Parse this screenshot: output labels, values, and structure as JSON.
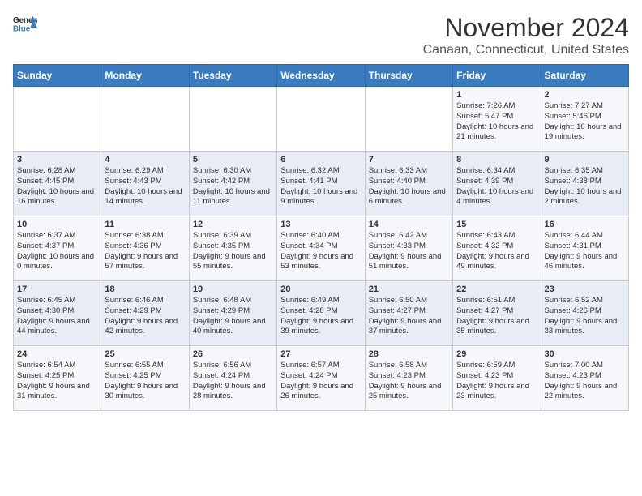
{
  "logo": {
    "text_general": "General",
    "text_blue": "Blue"
  },
  "title": "November 2024",
  "location": "Canaan, Connecticut, United States",
  "weekdays": [
    "Sunday",
    "Monday",
    "Tuesday",
    "Wednesday",
    "Thursday",
    "Friday",
    "Saturday"
  ],
  "weeks": [
    [
      {
        "day": "",
        "info": ""
      },
      {
        "day": "",
        "info": ""
      },
      {
        "day": "",
        "info": ""
      },
      {
        "day": "",
        "info": ""
      },
      {
        "day": "",
        "info": ""
      },
      {
        "day": "1",
        "info": "Sunrise: 7:26 AM\nSunset: 5:47 PM\nDaylight: 10 hours and 21 minutes."
      },
      {
        "day": "2",
        "info": "Sunrise: 7:27 AM\nSunset: 5:46 PM\nDaylight: 10 hours and 19 minutes."
      }
    ],
    [
      {
        "day": "3",
        "info": "Sunrise: 6:28 AM\nSunset: 4:45 PM\nDaylight: 10 hours and 16 minutes."
      },
      {
        "day": "4",
        "info": "Sunrise: 6:29 AM\nSunset: 4:43 PM\nDaylight: 10 hours and 14 minutes."
      },
      {
        "day": "5",
        "info": "Sunrise: 6:30 AM\nSunset: 4:42 PM\nDaylight: 10 hours and 11 minutes."
      },
      {
        "day": "6",
        "info": "Sunrise: 6:32 AM\nSunset: 4:41 PM\nDaylight: 10 hours and 9 minutes."
      },
      {
        "day": "7",
        "info": "Sunrise: 6:33 AM\nSunset: 4:40 PM\nDaylight: 10 hours and 6 minutes."
      },
      {
        "day": "8",
        "info": "Sunrise: 6:34 AM\nSunset: 4:39 PM\nDaylight: 10 hours and 4 minutes."
      },
      {
        "day": "9",
        "info": "Sunrise: 6:35 AM\nSunset: 4:38 PM\nDaylight: 10 hours and 2 minutes."
      }
    ],
    [
      {
        "day": "10",
        "info": "Sunrise: 6:37 AM\nSunset: 4:37 PM\nDaylight: 10 hours and 0 minutes."
      },
      {
        "day": "11",
        "info": "Sunrise: 6:38 AM\nSunset: 4:36 PM\nDaylight: 9 hours and 57 minutes."
      },
      {
        "day": "12",
        "info": "Sunrise: 6:39 AM\nSunset: 4:35 PM\nDaylight: 9 hours and 55 minutes."
      },
      {
        "day": "13",
        "info": "Sunrise: 6:40 AM\nSunset: 4:34 PM\nDaylight: 9 hours and 53 minutes."
      },
      {
        "day": "14",
        "info": "Sunrise: 6:42 AM\nSunset: 4:33 PM\nDaylight: 9 hours and 51 minutes."
      },
      {
        "day": "15",
        "info": "Sunrise: 6:43 AM\nSunset: 4:32 PM\nDaylight: 9 hours and 49 minutes."
      },
      {
        "day": "16",
        "info": "Sunrise: 6:44 AM\nSunset: 4:31 PM\nDaylight: 9 hours and 46 minutes."
      }
    ],
    [
      {
        "day": "17",
        "info": "Sunrise: 6:45 AM\nSunset: 4:30 PM\nDaylight: 9 hours and 44 minutes."
      },
      {
        "day": "18",
        "info": "Sunrise: 6:46 AM\nSunset: 4:29 PM\nDaylight: 9 hours and 42 minutes."
      },
      {
        "day": "19",
        "info": "Sunrise: 6:48 AM\nSunset: 4:29 PM\nDaylight: 9 hours and 40 minutes."
      },
      {
        "day": "20",
        "info": "Sunrise: 6:49 AM\nSunset: 4:28 PM\nDaylight: 9 hours and 39 minutes."
      },
      {
        "day": "21",
        "info": "Sunrise: 6:50 AM\nSunset: 4:27 PM\nDaylight: 9 hours and 37 minutes."
      },
      {
        "day": "22",
        "info": "Sunrise: 6:51 AM\nSunset: 4:27 PM\nDaylight: 9 hours and 35 minutes."
      },
      {
        "day": "23",
        "info": "Sunrise: 6:52 AM\nSunset: 4:26 PM\nDaylight: 9 hours and 33 minutes."
      }
    ],
    [
      {
        "day": "24",
        "info": "Sunrise: 6:54 AM\nSunset: 4:25 PM\nDaylight: 9 hours and 31 minutes."
      },
      {
        "day": "25",
        "info": "Sunrise: 6:55 AM\nSunset: 4:25 PM\nDaylight: 9 hours and 30 minutes."
      },
      {
        "day": "26",
        "info": "Sunrise: 6:56 AM\nSunset: 4:24 PM\nDaylight: 9 hours and 28 minutes."
      },
      {
        "day": "27",
        "info": "Sunrise: 6:57 AM\nSunset: 4:24 PM\nDaylight: 9 hours and 26 minutes."
      },
      {
        "day": "28",
        "info": "Sunrise: 6:58 AM\nSunset: 4:23 PM\nDaylight: 9 hours and 25 minutes."
      },
      {
        "day": "29",
        "info": "Sunrise: 6:59 AM\nSunset: 4:23 PM\nDaylight: 9 hours and 23 minutes."
      },
      {
        "day": "30",
        "info": "Sunrise: 7:00 AM\nSunset: 4:23 PM\nDaylight: 9 hours and 22 minutes."
      }
    ]
  ]
}
